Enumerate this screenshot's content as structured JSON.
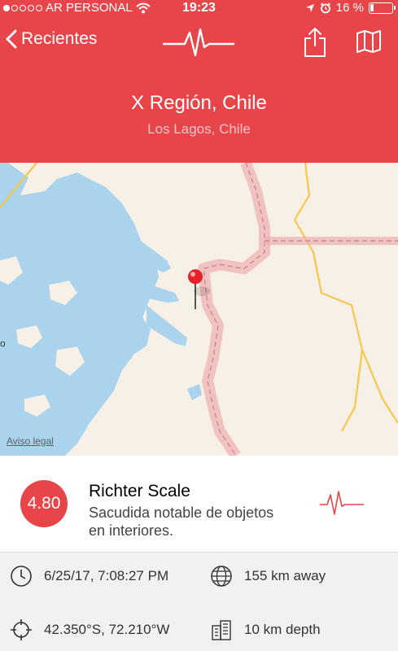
{
  "status_bar": {
    "carrier": "AR PERSONAL",
    "time": "19:23",
    "battery_text": "16 %",
    "battery_level": 0.16,
    "signal_dots_filled": 1,
    "signal_dots_total": 5
  },
  "nav": {
    "back_label": "Recientes"
  },
  "header": {
    "title": "X Región, Chile",
    "subtitle": "Los Lagos, Chile"
  },
  "map": {
    "legal_link": "Aviso legal",
    "left_edge_letter": "o"
  },
  "quake": {
    "magnitude": "4.80",
    "scale_name": "Richter Scale",
    "description": "Sacudida notable de objetos en interiores.",
    "datetime": "6/25/17, 7:08:27 PM",
    "distance": "155 km away",
    "coordinates": "42.350°S, 72.210°W",
    "depth": "10 km depth"
  },
  "colors": {
    "accent": "#e8454a",
    "water": "#aad3ee",
    "land": "#f6f0e6",
    "road": "#f5c84c",
    "border": "#e8a0a0"
  }
}
